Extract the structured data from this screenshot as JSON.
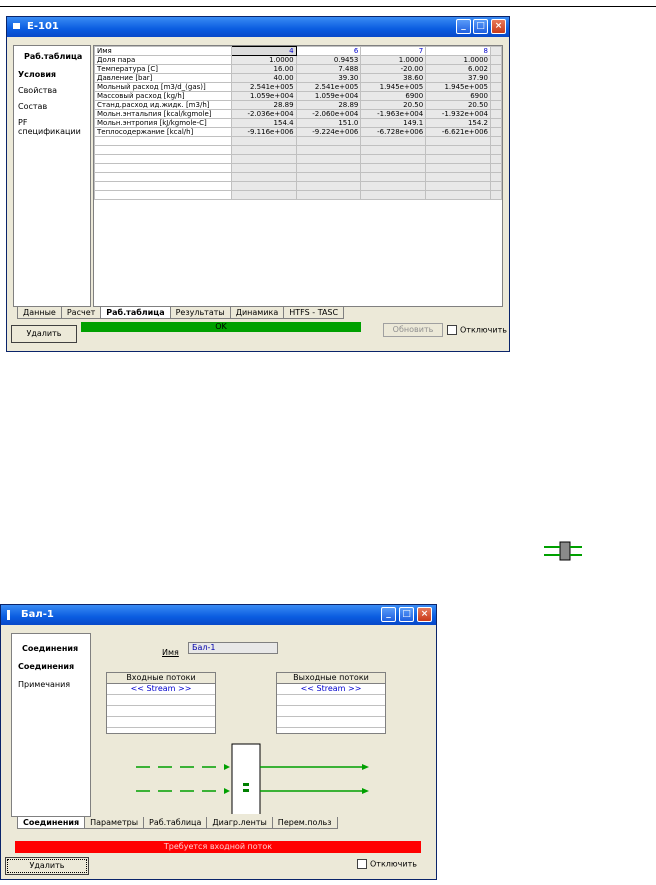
{
  "window1": {
    "title": "E-101",
    "nav_title": "Раб.таблица",
    "nav_items": [
      "Условия",
      "Свойства",
      "Состав",
      "PF спецификации"
    ],
    "table": {
      "header_label": "Имя",
      "streams": [
        "4",
        "6",
        "7",
        "8"
      ],
      "rows": [
        {
          "label": "Доля пара",
          "values": [
            "1.0000",
            "0.9453",
            "1.0000",
            "1.0000"
          ]
        },
        {
          "label": "Температура [C]",
          "values": [
            "16.00",
            "7.488",
            "-20.00",
            "6.002"
          ]
        },
        {
          "label": "Давление [bar]",
          "values": [
            "40.00",
            "39.30",
            "38.60",
            "37.90"
          ]
        },
        {
          "label": "Мольный расход [m3/d_(gas)]",
          "values": [
            "2.541e+005",
            "2.541e+005",
            "1.945e+005",
            "1.945e+005"
          ]
        },
        {
          "label": "Массовый расход [kg/h]",
          "values": [
            "1.059e+004",
            "1.059e+004",
            "6900",
            "6900"
          ]
        },
        {
          "label": "Станд.расход ид.жидк. [m3/h]",
          "values": [
            "28.89",
            "28.89",
            "20.50",
            "20.50"
          ]
        },
        {
          "label": "Мольн.энтальпия [kcal/kgmole]",
          "values": [
            "-2.036e+004",
            "-2.060e+004",
            "-1.963e+004",
            "-1.932e+004"
          ]
        },
        {
          "label": "Мольн.энтропия [kJ/kgmole-C]",
          "values": [
            "154.4",
            "151.0",
            "149.1",
            "154.2"
          ]
        },
        {
          "label": "Теплосодержание [kcal/h]",
          "values": [
            "-9.116e+006",
            "-9.224e+006",
            "-6.728e+006",
            "-6.621e+006"
          ]
        }
      ]
    },
    "tabs": [
      "Данные",
      "Расчет",
      "Раб.таблица",
      "Результаты",
      "Динамика",
      "HTFS - TASC"
    ],
    "active_tab": "Раб.таблица",
    "delete_label": "Удалить",
    "status_text": "OK",
    "update_label": "Обновить",
    "disable_label": "Отключить"
  },
  "window2": {
    "title": "Бал-1",
    "nav_title": "Соединения",
    "nav_items": [
      "Соединения",
      "Примечания"
    ],
    "name_label": "Имя",
    "name_value": "Бал-1",
    "inlet_header": "Входные потоки",
    "outlet_header": "Выходные потоки",
    "stream_placeholder": "<< Stream >>",
    "tabs": [
      "Соединения",
      "Параметры",
      "Раб.таблица",
      "Диагр.ленты",
      "Перем.польз"
    ],
    "active_tab": "Соединения",
    "status_text": "Требуется входной поток",
    "delete_label": "Удалить",
    "disable_label": "Отключить"
  },
  "colors": {
    "ok_status": "#00a000",
    "error_status": "#ff0000",
    "title_blue": "#0a5ce0"
  },
  "icons": [
    "balance-icon"
  ]
}
